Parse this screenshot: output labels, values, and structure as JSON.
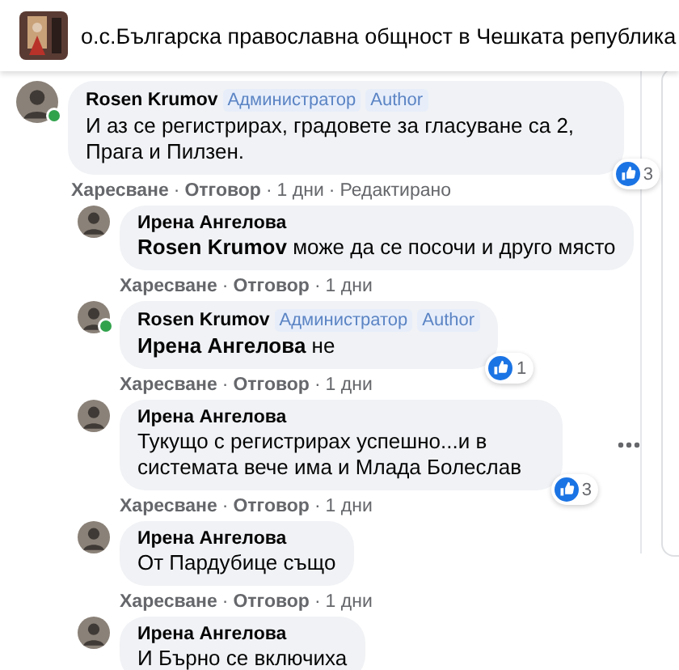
{
  "header": {
    "title": "о.с.Българска православна общност в Чешката република"
  },
  "comments": [
    {
      "author": "Rosen Krumov",
      "online": true,
      "badges": [
        "Администратор",
        "Author"
      ],
      "text": "И аз се регистрирах, градовете за гласуване са 2, Прага и Пилзен.",
      "reactions": "3",
      "actions": [
        {
          "kind": "link",
          "label": "Харесване"
        },
        {
          "kind": "separator",
          "label": "·"
        },
        {
          "kind": "link",
          "label": "Отговор"
        },
        {
          "kind": "separator",
          "label": "·"
        },
        {
          "kind": "time",
          "label": "1 дни"
        },
        {
          "kind": "separator",
          "label": "·"
        },
        {
          "kind": "note",
          "label": "Редактирано"
        }
      ],
      "children": [
        {
          "author": "Ирена Ангелова",
          "text": "**Rosen Krumov** може да се посочи и друго място",
          "actions": [
            {
              "kind": "link",
              "label": "Харесване"
            },
            {
              "kind": "separator",
              "label": "·"
            },
            {
              "kind": "link",
              "label": "Отговор"
            },
            {
              "kind": "separator",
              "label": "·"
            },
            {
              "kind": "time",
              "label": "1 дни"
            }
          ]
        },
        {
          "author": "Rosen Krumov",
          "online": true,
          "badges": [
            "Администратор",
            "Author"
          ],
          "text": "**Ирена Ангелова** не",
          "reactions": "1",
          "actions": [
            {
              "kind": "link",
              "label": "Харесване"
            },
            {
              "kind": "separator",
              "label": "·"
            },
            {
              "kind": "link",
              "label": "Отговор"
            },
            {
              "kind": "separator",
              "label": "·"
            },
            {
              "kind": "time",
              "label": "1 дни"
            }
          ]
        },
        {
          "author": "Ирена Ангелова",
          "text": "Тукущо с регистрирах успешно...и в системата вече има и Млада Болеслав",
          "reactions": "3",
          "menu": true,
          "actions": [
            {
              "kind": "link",
              "label": "Харесване"
            },
            {
              "kind": "separator",
              "label": "·"
            },
            {
              "kind": "link",
              "label": "Отговор"
            },
            {
              "kind": "separator",
              "label": "·"
            },
            {
              "kind": "time",
              "label": "1 дни"
            }
          ]
        },
        {
          "author": "Ирена Ангелова",
          "text": "От Пардубице също",
          "actions": [
            {
              "kind": "link",
              "label": "Харесване"
            },
            {
              "kind": "separator",
              "label": "·"
            },
            {
              "kind": "link",
              "label": "Отговор"
            },
            {
              "kind": "separator",
              "label": "·"
            },
            {
              "kind": "time",
              "label": "1 дни"
            }
          ]
        },
        {
          "author": "Ирена Ангелова",
          "text": "И Бърно се включиха"
        }
      ]
    }
  ]
}
